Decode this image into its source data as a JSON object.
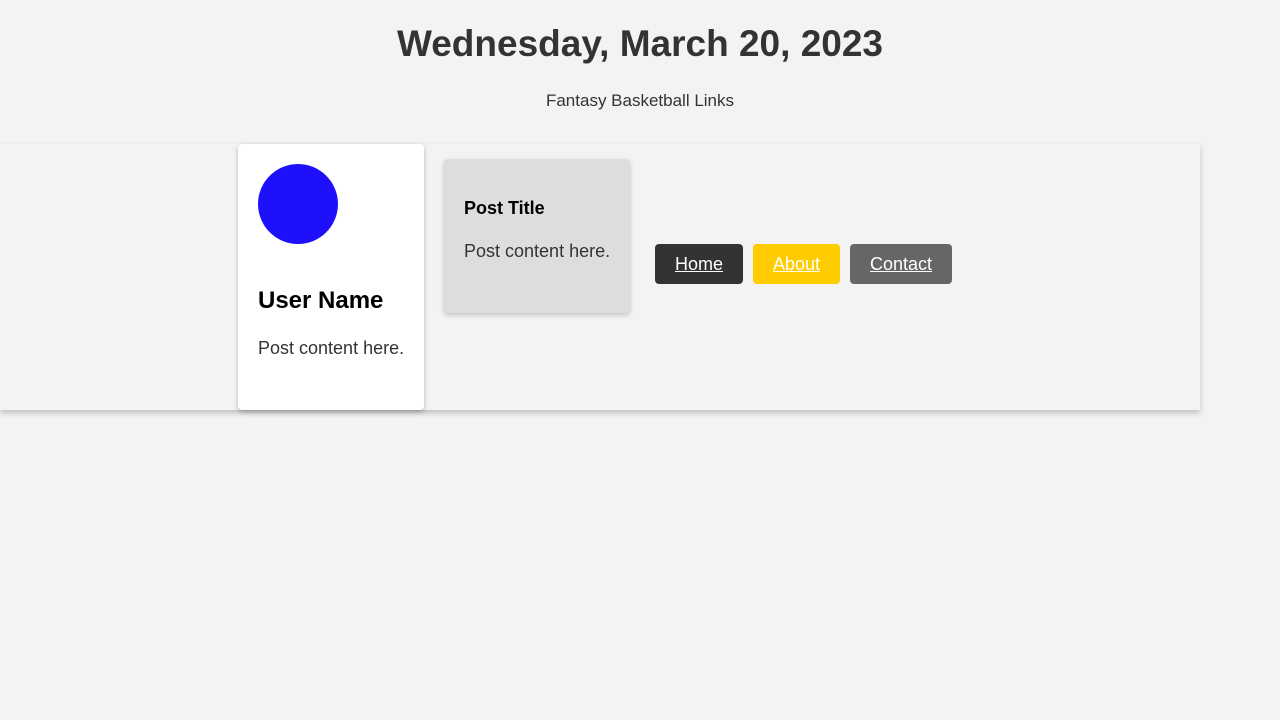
{
  "header": {
    "title": "Wednesday, March 20, 2023",
    "subtitle": "Fantasy Basketball Links"
  },
  "profile_card": {
    "avatar_color": "#1f10fb",
    "user_name": "User Name",
    "text": "Post content here."
  },
  "post_card": {
    "title": "Post Title",
    "text": "Post content here."
  },
  "nav": {
    "items": [
      {
        "label": "Home",
        "color": "#333333"
      },
      {
        "label": "About",
        "color": "#ffcc00"
      },
      {
        "label": "Contact",
        "color": "#666666"
      }
    ]
  }
}
